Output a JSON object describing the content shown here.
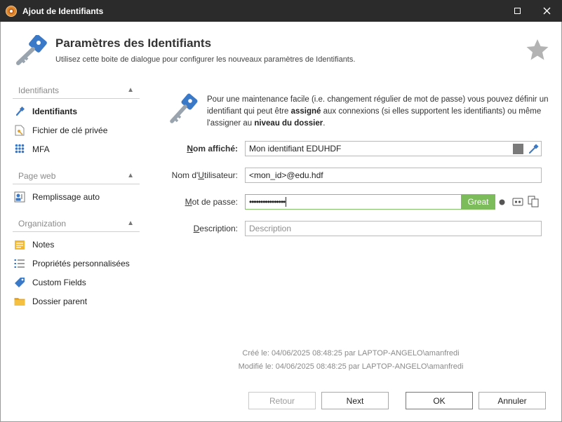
{
  "window": {
    "title": "Ajout de Identifiants"
  },
  "header": {
    "title": "Paramètres des Identifiants",
    "subtitle": "Utilisez cette boite de dialogue pour configurer les nouveaux paramètres de Identifiants."
  },
  "sidebar": {
    "sections": [
      {
        "label": "Identifiants",
        "items": [
          {
            "label": "Identifiants",
            "icon": "key-icon"
          },
          {
            "label": "Fichier de clé privée",
            "icon": "key-file-icon"
          },
          {
            "label": "MFA",
            "icon": "keypad-icon"
          }
        ]
      },
      {
        "label": "Page web",
        "items": [
          {
            "label": "Remplissage auto",
            "icon": "autofill-icon"
          }
        ]
      },
      {
        "label": "Organization",
        "items": [
          {
            "label": "Notes",
            "icon": "notes-icon"
          },
          {
            "label": "Propriétés personnalisées",
            "icon": "list-icon"
          },
          {
            "label": "Custom Fields",
            "icon": "tag-icon"
          },
          {
            "label": "Dossier parent",
            "icon": "folder-icon"
          }
        ]
      }
    ]
  },
  "info": {
    "part1": "Pour une maintenance facile (i.e. changement régulier de mot de passe) vous pouvez définir un identifiant qui peut être ",
    "bold1": "assigné",
    "part2": " aux connexions (si elles supportent les identifiants) ou même l'assigner au ",
    "bold2": "niveau du dossier",
    "part3": "."
  },
  "form": {
    "display_name": {
      "label_pre": "",
      "label_u": "N",
      "label_post": "om affiché:",
      "value": "Mon identifiant EDUHDF"
    },
    "username": {
      "label_pre": "Nom d'",
      "label_u": "U",
      "label_post": "tilisateur:",
      "value": "<mon_id>@edu.hdf"
    },
    "password": {
      "label_pre": "",
      "label_u": "M",
      "label_post": "ot de passe:",
      "value": "••••••••••••••••",
      "strength": "Great"
    },
    "description": {
      "label_pre": "",
      "label_u": "D",
      "label_post": "escription:",
      "placeholder": "Description"
    }
  },
  "meta": {
    "created": "Créé le: 04/06/2025 08:48:25 par LAPTOP-ANGELO\\amanfredi",
    "modified": "Modifié le: 04/06/2025 08:48:25 par LAPTOP-ANGELO\\amanfredi"
  },
  "buttons": {
    "back": "Retour",
    "next": "Next",
    "ok": "OK",
    "cancel": "Annuler"
  },
  "colors": {
    "accent_blue": "#3a78c8",
    "strength_green": "#7cbc5a",
    "titlebar": "#2b2b2b"
  }
}
